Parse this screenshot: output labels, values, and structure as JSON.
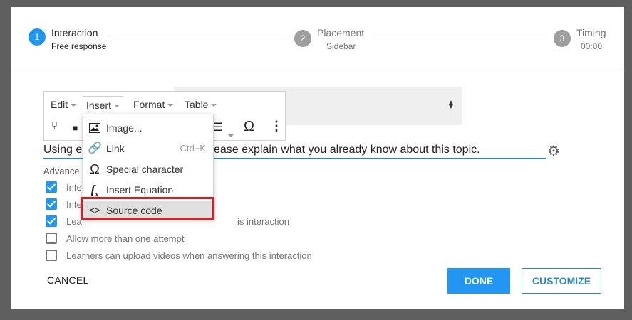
{
  "stepper": {
    "steps": [
      {
        "number": "1",
        "title": "Interaction",
        "subtitle": "Free response"
      },
      {
        "number": "2",
        "title": "Placement",
        "subtitle": "Sidebar"
      },
      {
        "number": "3",
        "title": "Timing",
        "subtitle": "00:00"
      }
    ]
  },
  "menubar": {
    "edit": "Edit",
    "insert": "Insert",
    "format": "Format",
    "table": "Table"
  },
  "toolbar_icons": [
    "fork-icon",
    "video-icon",
    "list-icon",
    "omega-icon",
    "more-icon"
  ],
  "insert_menu": {
    "items": [
      {
        "label": "Image...",
        "icon": "image-icon",
        "shortcut": ""
      },
      {
        "label": "Link",
        "icon": "link-icon",
        "shortcut": "Ctrl+K"
      },
      {
        "label": "Special character",
        "icon": "omega-icon",
        "shortcut": ""
      },
      {
        "label": "Insert Equation",
        "icon": "equation-icon",
        "shortcut": ""
      },
      {
        "label": "Source code",
        "icon": "source-code-icon",
        "shortcut": ""
      }
    ]
  },
  "editor": {
    "text_left": "Using e",
    "text_right": "ease explain what you already know about this topic."
  },
  "advanced_label": "Advance",
  "options": [
    {
      "label": "Inte",
      "checked": true
    },
    {
      "label": "Inte",
      "checked": true
    },
    {
      "label": "Lea",
      "label_right": "is interaction",
      "checked": true
    },
    {
      "label": "Allow more than one attempt",
      "checked": false
    },
    {
      "label": "Learners can upload videos when answering this interaction",
      "checked": false
    }
  ],
  "footer": {
    "cancel": "CANCEL",
    "done": "DONE",
    "customize": "CUSTOMIZE"
  },
  "colors": {
    "accent": "#2196f3",
    "highlight": "#e01b24"
  }
}
